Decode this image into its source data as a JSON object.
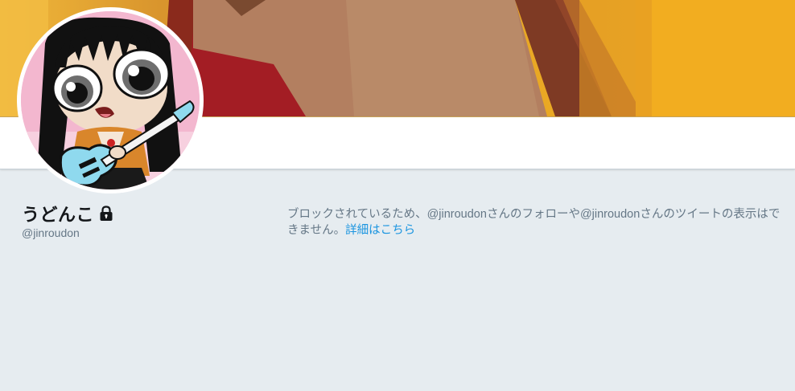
{
  "profile": {
    "display_name": "うどんこ",
    "handle": "@jinroudon",
    "protected_icon": "lock-icon",
    "avatar_icon": "cartoon-girl-guitar-avatar"
  },
  "blocked_notice": {
    "message": "ブロックされているため、@jinroudonさんのフォローや@jinroudonさんのツイートの表示はできません。",
    "link_label": "詳細はこちら"
  },
  "colors": {
    "background": "#e6ecf0",
    "name": "#14171a",
    "secondary_text": "#657786",
    "link": "#1b95e0",
    "banner_primary": "#f4b21f"
  }
}
